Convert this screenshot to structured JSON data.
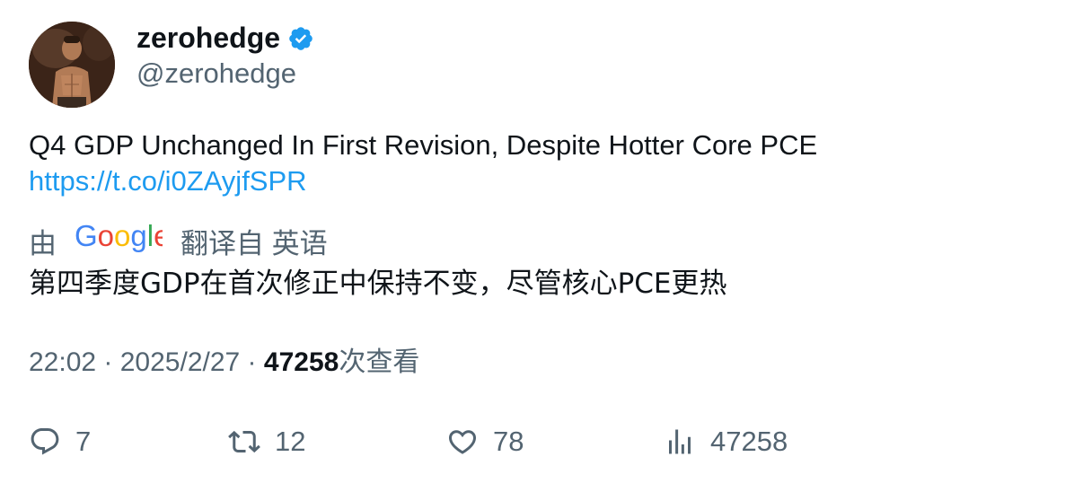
{
  "author": {
    "display_name": "zerohedge",
    "handle": "@zerohedge",
    "verified": true
  },
  "tweet": {
    "text": "Q4 GDP Unchanged In First Revision, Despite Hotter Core PCE",
    "link": "https://t.co/i0ZAyjfSPR"
  },
  "translation": {
    "prefix": "由",
    "provider": "Google",
    "suffix": "翻译自 英语",
    "text": "第四季度GDP在首次修正中保持不变，尽管核心PCE更热"
  },
  "meta": {
    "time": "22:02",
    "sep1": " · ",
    "date": "2025/2/27",
    "sep2": " · ",
    "views": "47258",
    "views_label": "次查看"
  },
  "actions": {
    "replies": "7",
    "retweets": "12",
    "likes": "78",
    "views": "47258"
  },
  "colors": {
    "link": "#1d9bf0",
    "verified": "#1d9bf0",
    "text": "#0f1419",
    "secondary": "#536471"
  }
}
